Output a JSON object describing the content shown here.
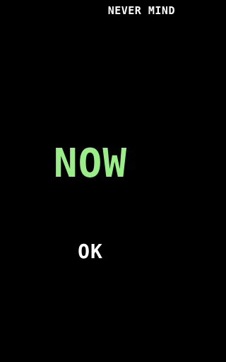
{
  "header": {
    "dismiss_label": "NEVER MIND"
  },
  "main": {
    "headline": "NOW",
    "confirm_label": "OK"
  },
  "colors": {
    "background": "#000000",
    "headline": "#99ee88",
    "text": "#ffffff"
  }
}
